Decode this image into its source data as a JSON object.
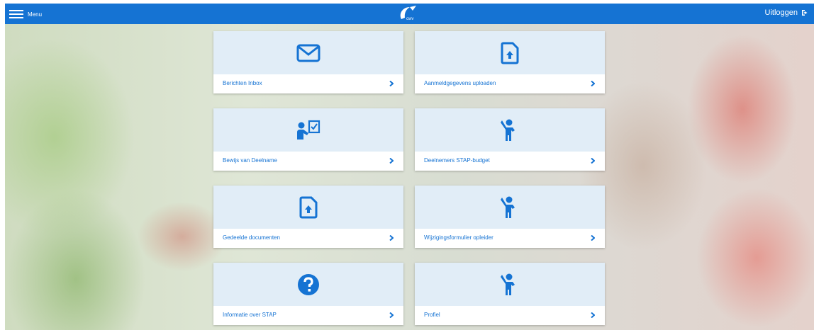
{
  "header": {
    "menu_label": "Menu",
    "logo_text": "cwv",
    "logout_label": "Uitloggen"
  },
  "tiles": [
    {
      "label": "Berichten Inbox",
      "icon": "envelope-icon"
    },
    {
      "label": "Aanmeldgegevens uploaden",
      "icon": "file-upload-icon"
    },
    {
      "label": "Bewijs van Deelname",
      "icon": "person-checklist-icon"
    },
    {
      "label": "Deelnemers STAP-budget",
      "icon": "person-icon"
    },
    {
      "label": "Gedeelde documenten",
      "icon": "file-upload-icon"
    },
    {
      "label": "Wijzigingsformulier opleider",
      "icon": "person-icon"
    },
    {
      "label": "Informatie over STAP",
      "icon": "question-circle-icon"
    },
    {
      "label": "Profiel",
      "icon": "person-icon"
    }
  ],
  "colors": {
    "brand_blue": "#1573d3",
    "tile_bg": "#e1edf7"
  }
}
